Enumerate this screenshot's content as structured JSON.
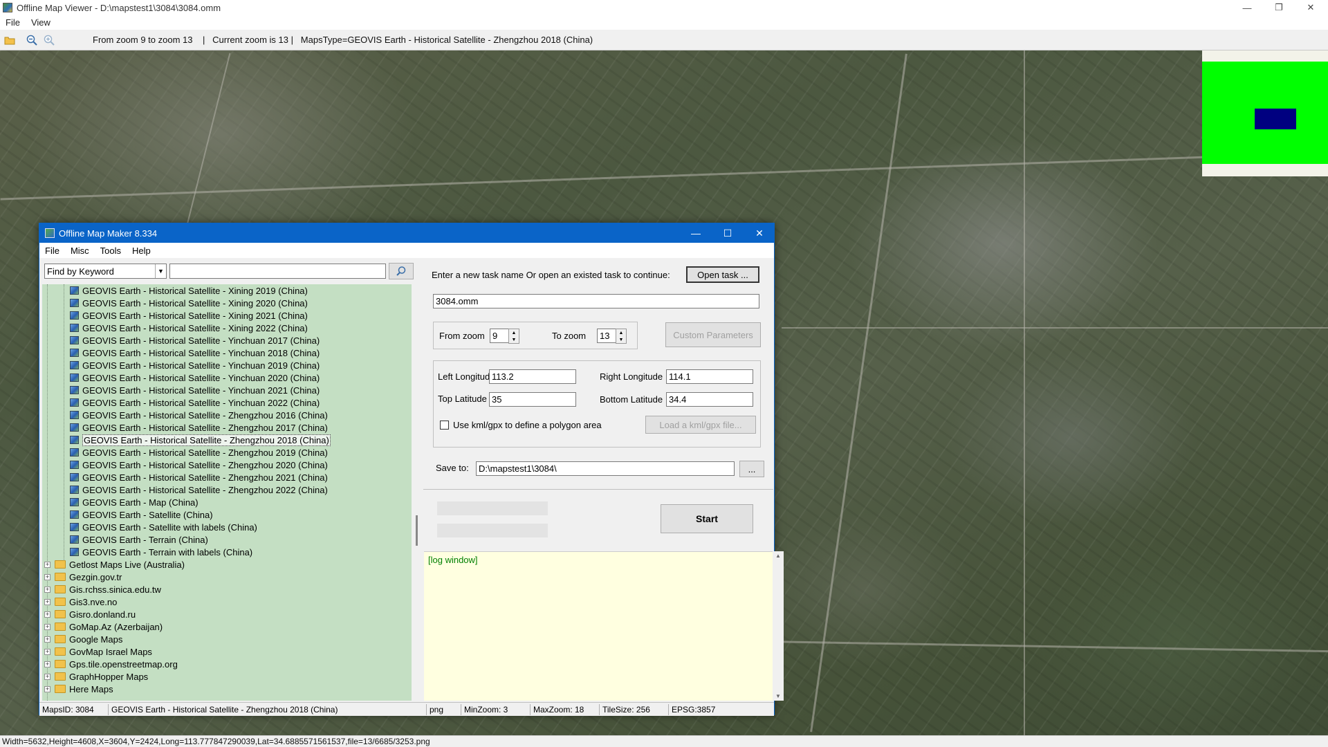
{
  "window": {
    "title": "Offline Map Viewer - D:\\mapstest1\\3084\\3084.omm",
    "menu": [
      "File",
      "View"
    ],
    "controls": {
      "minimize": "—",
      "restore": "❐",
      "close": "✕"
    }
  },
  "toolbar": {
    "info": "From zoom 9 to zoom 13    |   Current zoom is 13 |   MapsType=GEOVIS Earth - Historical Satellite - Zhengzhou 2018 (China)",
    "icons": [
      "open-folder-icon",
      "zoom-out-icon",
      "zoom-in-icon"
    ]
  },
  "map": {
    "overview_colors": {
      "background": "#00ff00",
      "viewport": "#000080"
    }
  },
  "viewer_status": "Width=5632,Height=4608,X=3604,Y=2424,Long=113.777847290039,Lat=34.6885571561537,file=13/6685/3253.png",
  "dialog": {
    "title": "Offline Map Maker 8.334",
    "menu": [
      "File",
      "Misc",
      "Tools",
      "Help"
    ],
    "controls": {
      "minimize": "—",
      "maximize": "☐",
      "close": "✕"
    },
    "search": {
      "mode": "Find by Keyword",
      "keyword": ""
    },
    "tree": {
      "leaves": [
        "GEOVIS Earth - Historical Satellite - Xining 2019 (China)",
        "GEOVIS Earth - Historical Satellite - Xining 2020 (China)",
        "GEOVIS Earth - Historical Satellite - Xining 2021 (China)",
        "GEOVIS Earth - Historical Satellite - Xining 2022 (China)",
        "GEOVIS Earth - Historical Satellite - Yinchuan 2017 (China)",
        "GEOVIS Earth - Historical Satellite - Yinchuan 2018 (China)",
        "GEOVIS Earth - Historical Satellite - Yinchuan 2019 (China)",
        "GEOVIS Earth - Historical Satellite - Yinchuan 2020 (China)",
        "GEOVIS Earth - Historical Satellite - Yinchuan 2021 (China)",
        "GEOVIS Earth - Historical Satellite - Yinchuan 2022 (China)",
        "GEOVIS Earth - Historical Satellite - Zhengzhou 2016 (China)",
        "GEOVIS Earth - Historical Satellite - Zhengzhou 2017 (China)",
        "GEOVIS Earth - Historical Satellite - Zhengzhou 2018 (China)",
        "GEOVIS Earth - Historical Satellite - Zhengzhou 2019 (China)",
        "GEOVIS Earth - Historical Satellite - Zhengzhou 2020 (China)",
        "GEOVIS Earth - Historical Satellite - Zhengzhou 2021 (China)",
        "GEOVIS Earth - Historical Satellite - Zhengzhou 2022 (China)",
        "GEOVIS Earth - Map (China)",
        "GEOVIS Earth - Satellite (China)",
        "GEOVIS Earth - Satellite with labels (China)",
        "GEOVIS Earth - Terrain (China)",
        "GEOVIS Earth - Terrain with labels (China)"
      ],
      "selected_leaf": "GEOVIS Earth - Historical Satellite - Zhengzhou 2018 (China)",
      "folders": [
        "Getlost Maps Live (Australia)",
        "Gezgin.gov.tr",
        "Gis.rchss.sinica.edu.tw",
        "Gis3.nve.no",
        "Gisro.donland.ru",
        "GoMap.Az (Azerbaijan)",
        "Google Maps",
        "GovMap Israel Maps",
        "Gps.tile.openstreetmap.org",
        "GraphHopper Maps",
        "Here Maps"
      ],
      "expander_symbol": "+"
    },
    "task": {
      "prompt": "Enter a new task name Or open an existed task to continue:",
      "open_button": "Open task ...",
      "name": "3084.omm"
    },
    "zoom": {
      "from_label": "From zoom",
      "from_value": "9",
      "to_label": "To zoom",
      "to_value": "13",
      "custom_button": "Custom Parameters"
    },
    "area": {
      "left_lon_label": "Left Longitude",
      "left_lon": "113.2",
      "right_lon_label": "Right Longitude",
      "right_lon": "114.1",
      "top_lat_label": "Top Latitude",
      "top_lat": "35",
      "bottom_lat_label": "Bottom Latitude",
      "bottom_lat": "34.4",
      "kml_label": "Use kml/gpx to define a polygon area",
      "kml_checked": false,
      "load_kml_button": "Load a kml/gpx file..."
    },
    "save": {
      "label": "Save to:",
      "path": "D:\\mapstest1\\3084\\",
      "browse_button": "..."
    },
    "start_button": "Start",
    "log": "[log window]",
    "status": {
      "maps_id": "MapsID: 3084",
      "maps_name": "GEOVIS Earth - Historical Satellite - Zhengzhou 2018 (China)",
      "format": "png",
      "min_zoom": "MinZoom: 3",
      "max_zoom": "MaxZoom: 18",
      "tile_size": "TileSize: 256",
      "epsg": "EPSG:3857"
    }
  }
}
